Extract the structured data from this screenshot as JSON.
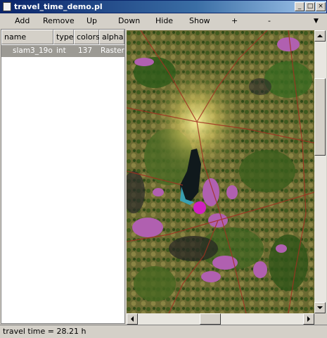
{
  "window": {
    "title": "travel_time_demo.pl",
    "buttons": {
      "minimize": "_",
      "maximize": "□",
      "close": "×"
    }
  },
  "toolbar": {
    "add": "Add",
    "remove": "Remove",
    "up": "Up",
    "down": "Down",
    "hide": "Hide",
    "show": "Show",
    "plus": "+",
    "minus": "-",
    "dropdown": "▼"
  },
  "layers": {
    "columns": [
      "name",
      "type",
      "colors",
      "alpha"
    ],
    "rows": [
      {
        "name": "slam3_19o",
        "type": "int",
        "colors": "137",
        "alpha": "Raster"
      }
    ]
  },
  "map": {
    "icon": "raster-map-view"
  },
  "scrollbars": {
    "vertical": {
      "position": 0.15
    },
    "horizontal": {
      "position": 0.52
    }
  },
  "status": {
    "text": "travel time = 28.21 h"
  }
}
